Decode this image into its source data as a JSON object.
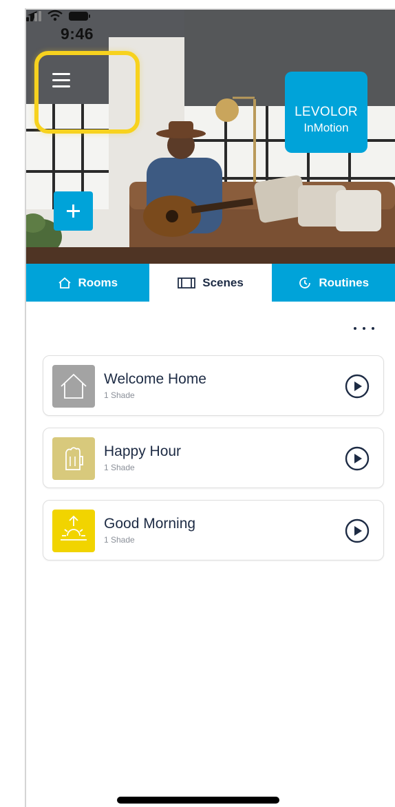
{
  "status_bar": {
    "time": "9:46"
  },
  "hero": {
    "logo_brand": "LEVOLOR",
    "logo_sub": "InMotion"
  },
  "tabs": [
    {
      "label": "Rooms",
      "icon": "house-icon",
      "active": false
    },
    {
      "label": "Scenes",
      "icon": "film-icon",
      "active": true
    },
    {
      "label": "Routines",
      "icon": "clock-icon",
      "active": false
    }
  ],
  "scenes": [
    {
      "name": "Welcome Home",
      "count": "1 Shade",
      "icon": "house-icon",
      "color": "#a3a3a3"
    },
    {
      "name": "Happy Hour",
      "count": "1 Shade",
      "icon": "beer-mug-icon",
      "color": "#d8c97c"
    },
    {
      "name": "Good Morning",
      "count": "1 Shade",
      "icon": "sunrise-icon",
      "color": "#f1d400"
    }
  ],
  "colors": {
    "accent": "#00a3d9",
    "highlight": "#f7d21e",
    "text_dark": "#1d2b44"
  }
}
